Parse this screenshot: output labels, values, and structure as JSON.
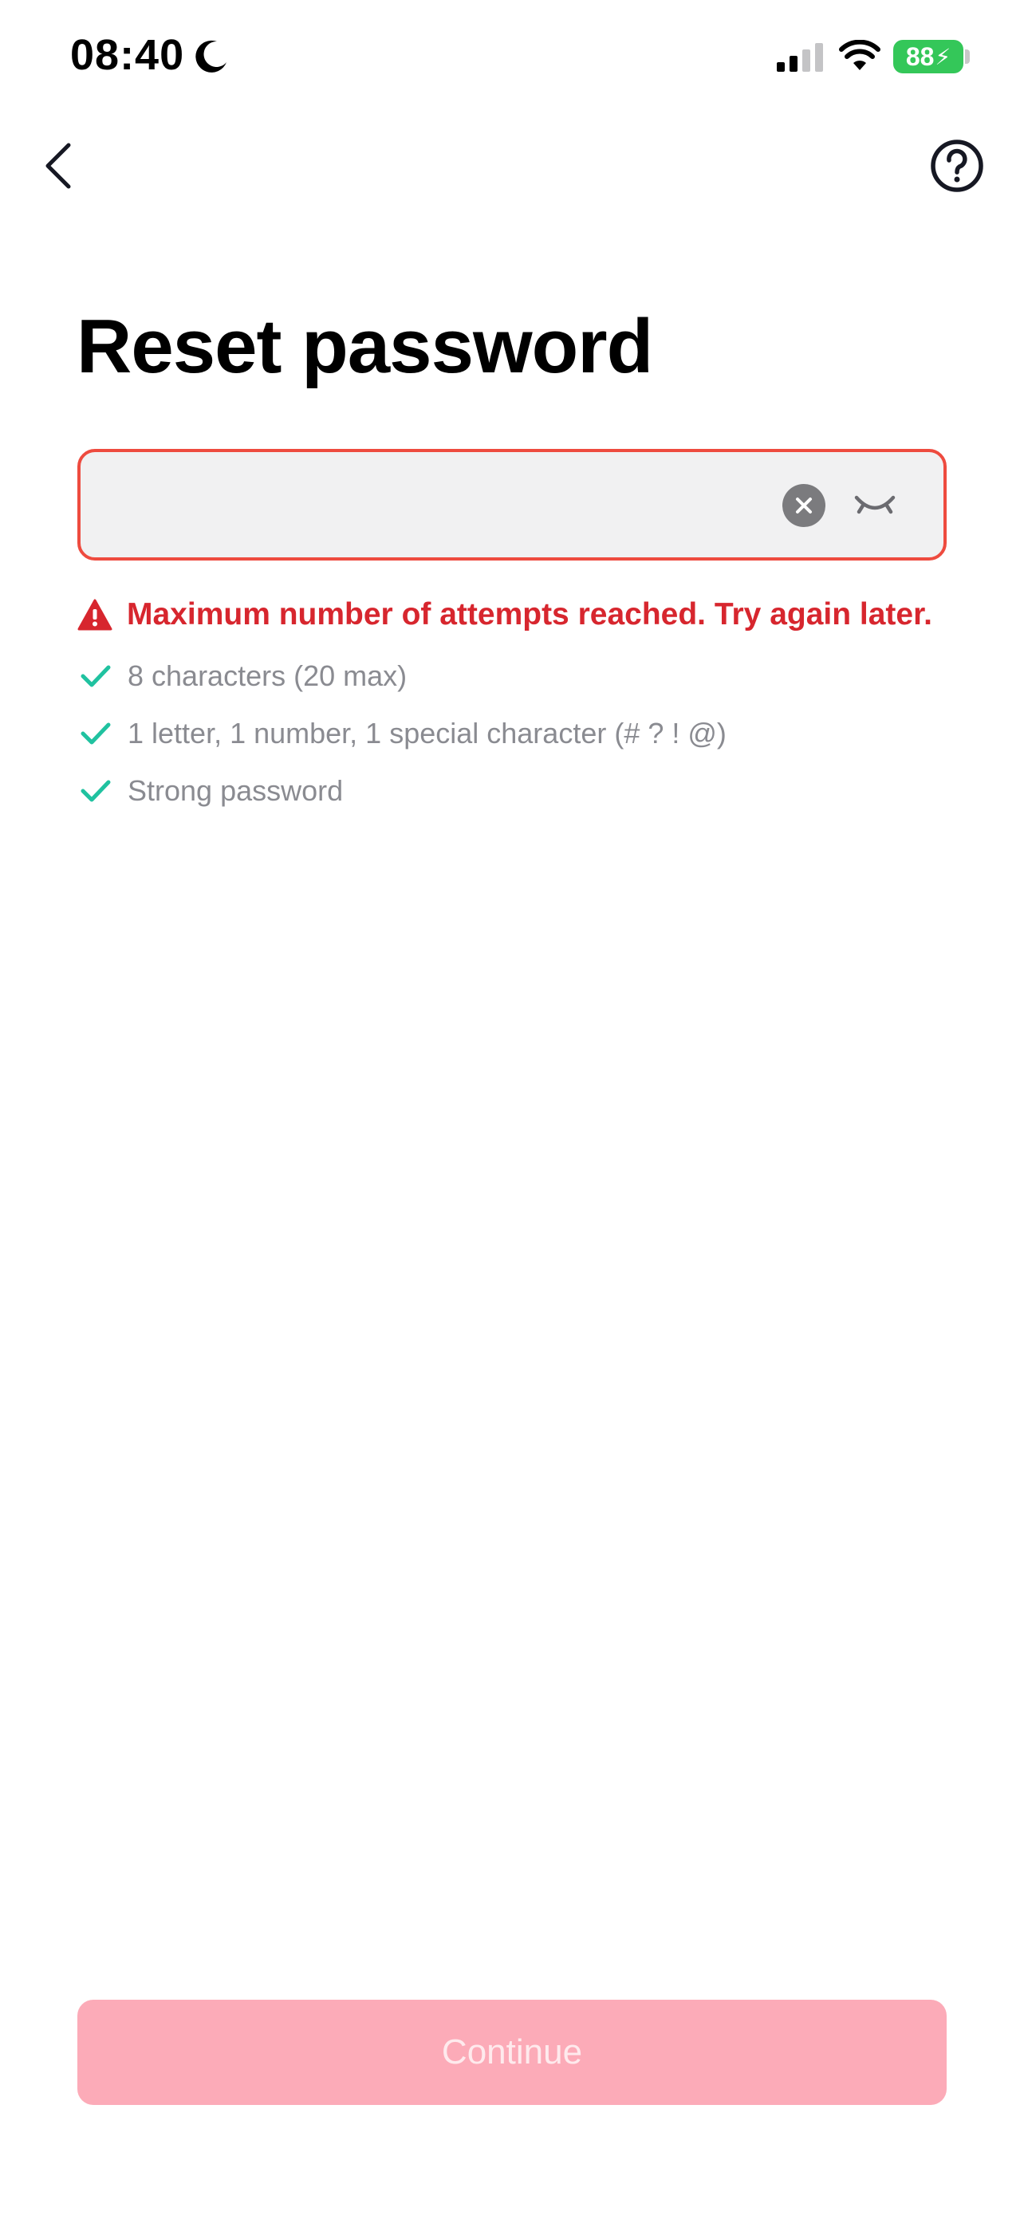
{
  "status_bar": {
    "time": "08:40",
    "battery_percent": "88",
    "icons": [
      "moon-icon",
      "signal-icon",
      "wifi-icon",
      "battery-icon"
    ]
  },
  "nav": {
    "back_icon": "chevron-left-icon",
    "help_icon": "question-circle-icon"
  },
  "page": {
    "title": "Reset password"
  },
  "password_field": {
    "value": "",
    "placeholder": "",
    "clear_icon": "clear-x-icon",
    "visibility_icon": "eye-closed-icon"
  },
  "error": {
    "icon": "warning-triangle-icon",
    "message": "Maximum number of attempts reached. Try again later."
  },
  "rules": [
    {
      "icon": "checkmark-icon",
      "text": "8 characters (20 max)"
    },
    {
      "icon": "checkmark-icon",
      "text": "1 letter, 1 number, 1 special character (# ? ! @)"
    },
    {
      "icon": "checkmark-icon",
      "text": "Strong password"
    }
  ],
  "continue_button": {
    "label": "Continue",
    "enabled": false
  },
  "colors": {
    "error": "#d7262e",
    "field_border_error": "#ee4b3f",
    "check": "#20c2a0",
    "button_disabled": "#fcabb8",
    "battery": "#34c759"
  }
}
